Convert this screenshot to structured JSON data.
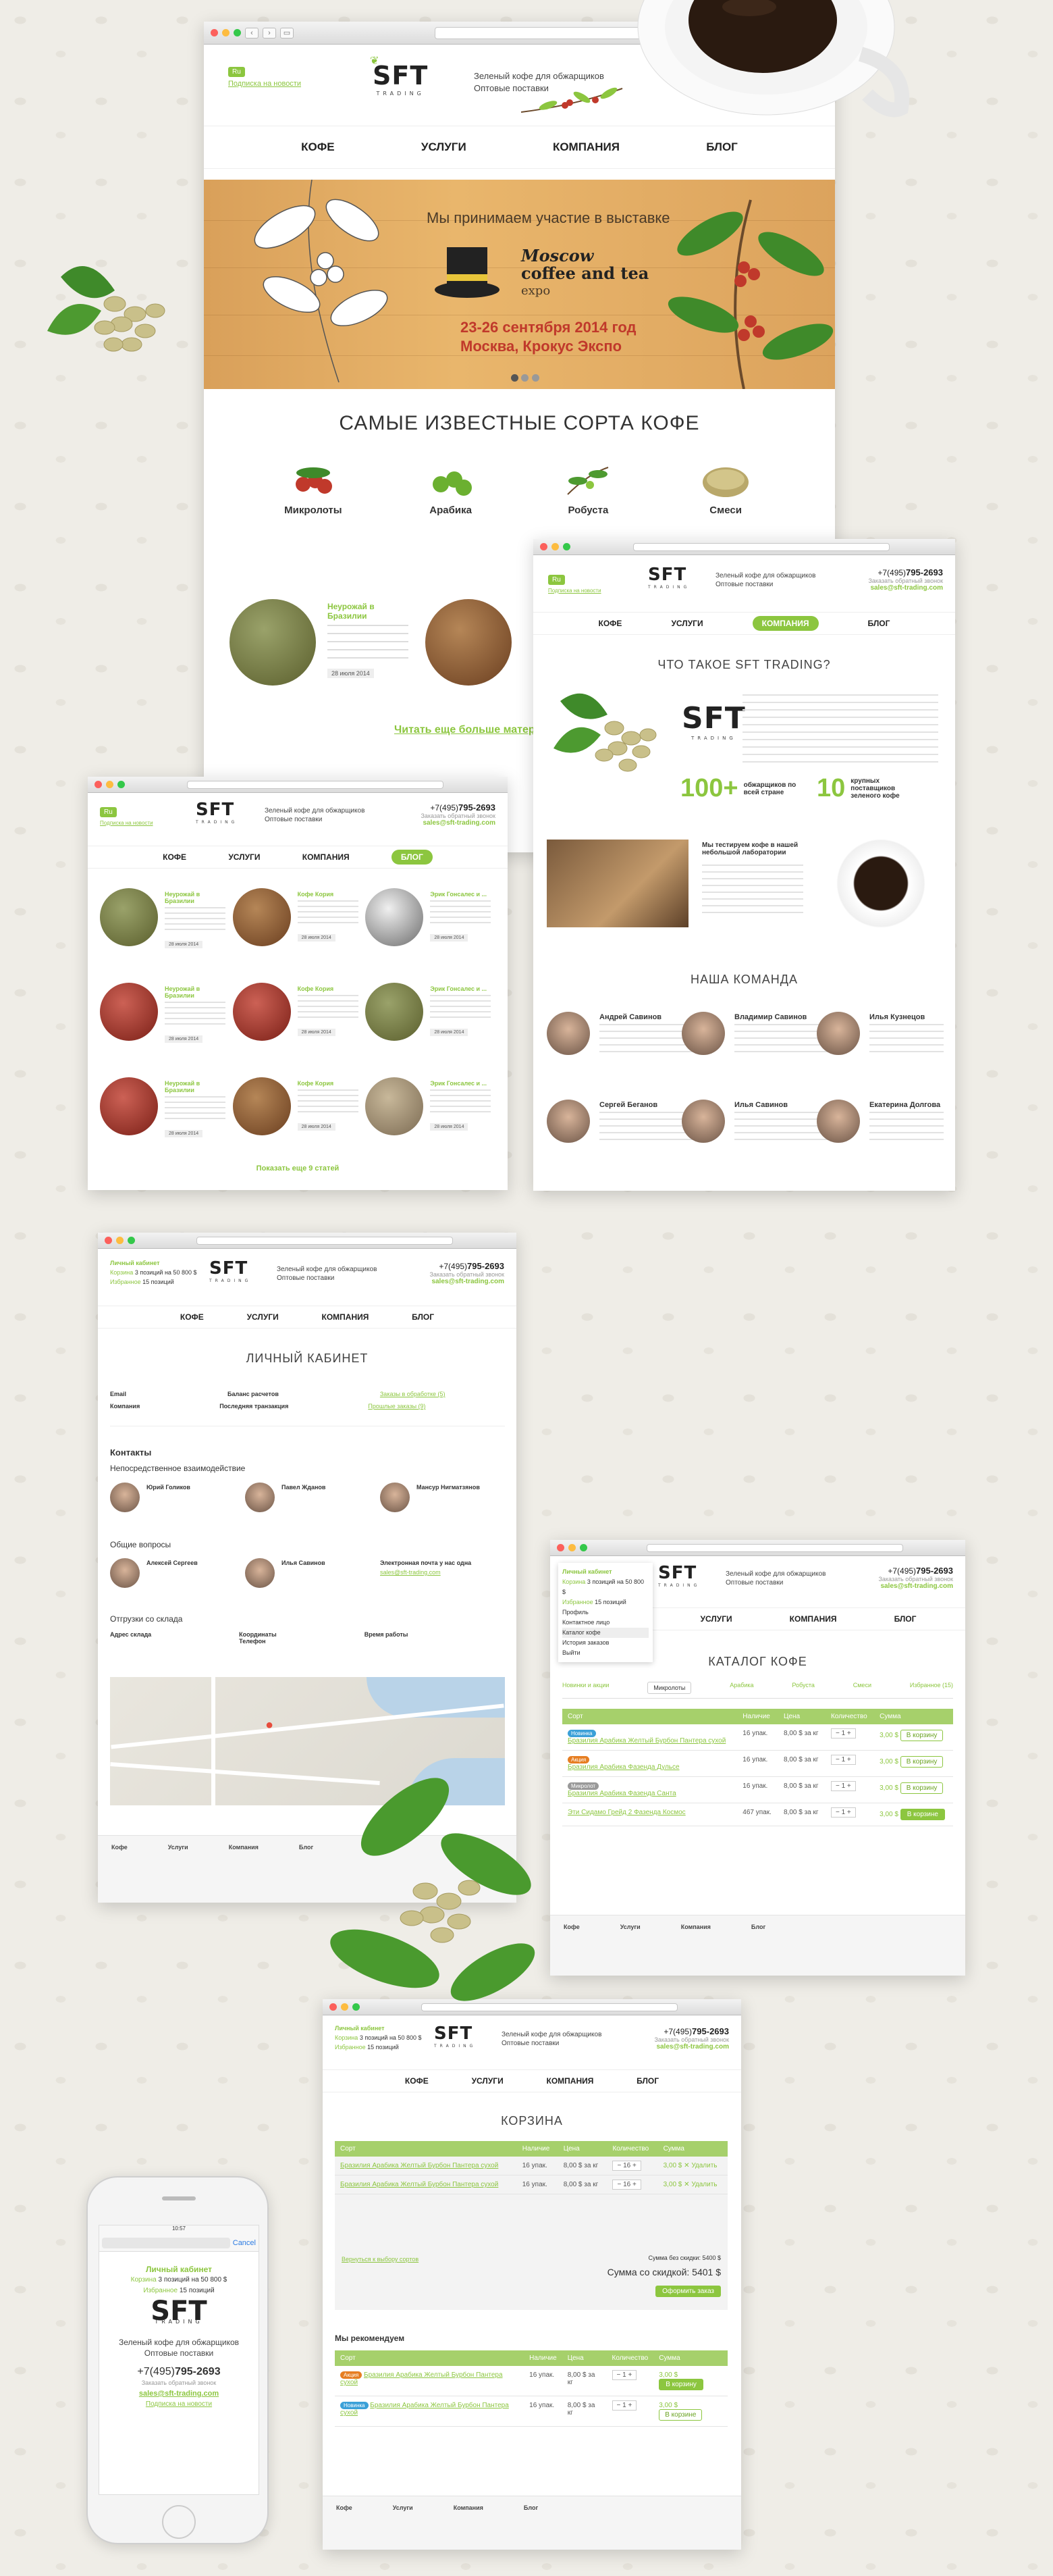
{
  "site": {
    "logo_main": "SFT",
    "logo_sub": "TRADING",
    "tagline_1": "Зеленый кофе для обжарщиков",
    "tagline_2": "Оптовые поставки",
    "lang": "Ru",
    "subscribe": "Подписка на новости",
    "phone_prefix": "+7(495)",
    "phone_number": "795-2693",
    "phone_note": "Заказать обратный звонок",
    "email": "sales@sft-trading.com",
    "menu": [
      "КОФЕ",
      "УСЛУГИ",
      "КОМПАНИЯ",
      "БЛОГ"
    ]
  },
  "hero": {
    "line1": "Мы принимаем участие в выставке",
    "expo1": "Moscow",
    "expo2": "coffee and tea",
    "expo3": "expo",
    "dates": "23-26 сентября 2014 год",
    "place": "Москва, Крокус Экспо"
  },
  "varieties": {
    "title": "САМЫЕ ИЗВЕСТНЫЕ СОРТА КОФЕ",
    "items": [
      "Микролоты",
      "Арабика",
      "Робуста",
      "Смеси"
    ]
  },
  "news_preview": {
    "item_title": "Неурожай в Бразилии",
    "item_date": "28 июля 2014",
    "more": "Читать еще больше матер"
  },
  "about": {
    "title": "ЧТО ТАКОЕ SFT TRADING?",
    "stat1_num": "100+",
    "stat1_txt": "обжарщиков по всей стране",
    "stat2_num": "10",
    "stat2_txt": "крупных поставщиков зеленого кофе",
    "lab_title": "Мы тестируем кофе в нашей небольшой лаборатории",
    "team_title": "НАША КОМАНДА",
    "team": [
      {
        "name": "Андрей Савинов"
      },
      {
        "name": "Владимир Савинов"
      },
      {
        "name": "Илья Кузнецов"
      },
      {
        "name": "Сергей Беганов"
      },
      {
        "name": "Илья Савинов"
      },
      {
        "name": "Екатерина Долгова"
      }
    ]
  },
  "blog": {
    "more_posts": "Показать еще 9 статей",
    "date": "28 июля 2014",
    "titles": [
      "Неурожай в Бразилии",
      "Кофе Кория",
      "Эрик Гонсалес и ...",
      "Неурожай в Бразилии",
      "Кофе Кория",
      "Эрик Гонсалес и ...",
      "Неурожай в Бразилии",
      "Кофе Кория",
      "Эрик Гонсалес и ..."
    ]
  },
  "cabinet": {
    "user_menu": "Личный кабинет",
    "cart_link": "Корзина",
    "cart_info": "3 позиций на 50 800 $",
    "fav_link": "Избранное",
    "fav_info": "15 позиций",
    "title": "ЛИЧНЫЙ КАБИНЕТ",
    "email_label": "Email",
    "company_label": "Компания",
    "balance_label": "Баланс расчетов",
    "last_label": "Последняя транзакция",
    "orders_link": "Заказы в обработке (5)",
    "history_link": "Прошлые заказы (9)",
    "contacts_title": "Контакты",
    "direct_title": "Непосредственное взаимодействие",
    "direct_people": [
      "Юрий Голиков",
      "Павел Жданов",
      "Мансур Нигматзянов"
    ],
    "general_title": "Общие вопросы",
    "general_people": [
      "Алексей Сергеев",
      "Илья Савинов"
    ],
    "email_note": "Электронная почта у нас одна",
    "stock_title": "Отгрузки со склада",
    "stock_address": "Адрес склада",
    "stock_coords": "Координаты",
    "stock_hours": "Время работы",
    "stock_phone": "Телефон"
  },
  "catalog": {
    "title": "КАТАЛОГ КОФЕ",
    "dropdown": [
      "Профиль",
      "Контактное лицо",
      "Каталог кофе",
      "История заказов",
      "Выйти"
    ],
    "tabs": [
      "Новинки и акции",
      "Микролоты",
      "Арабика",
      "Робуста",
      "Смеси",
      "Избранное (15)"
    ],
    "headers": [
      "Сорт",
      "Наличие",
      "Цена",
      "Количество",
      "Сумма"
    ],
    "rows": [
      {
        "name": "Бразилия Арабика Желтый Бурбон Пантера сухой",
        "badge": "Новинка",
        "stock": "16 упак.",
        "price": "8,00 $ за кг",
        "qty": "1",
        "sum": "3,00 $",
        "action": "В корзину"
      },
      {
        "name": "Бразилия Арабика Фазенда Дульсе",
        "badge": "Акция",
        "stock": "16 упак.",
        "price": "8,00 $ за кг",
        "qty": "1",
        "sum": "3,00 $",
        "action": "В корзину"
      },
      {
        "name": "Бразилия Арабика Фазенда Санта",
        "badge": "Микролот",
        "stock": "16 упак.",
        "price": "8,00 $ за кг",
        "qty": "1",
        "sum": "3,00 $",
        "action": "В корзину"
      },
      {
        "name": "Эти Сидамо Грейд 2 Фазенда Космос",
        "badge": "",
        "stock": "467 упак.",
        "price": "8,00 $ за кг",
        "qty": "1",
        "sum": "3,00 $",
        "action": "В корзине"
      }
    ],
    "footer_cols": [
      "Кофе",
      "Услуги",
      "Компания",
      "Блог"
    ]
  },
  "cart": {
    "title": "КОРЗИНА",
    "rows": [
      {
        "name": "Бразилия Арабика Желтый Бурбон Пантера сухой",
        "stock": "16 упак.",
        "price": "8,00 $ за кг",
        "qty": "16",
        "sum": "3,00 $",
        "action": "Удалить"
      },
      {
        "name": "Бразилия Арабика Желтый Бурбон Пантера сухой",
        "stock": "16 упак.",
        "price": "8,00 $ за кг",
        "qty": "16",
        "sum": "3,00 $",
        "action": "Удалить"
      }
    ],
    "back": "Вернуться к выбору сортов",
    "sum_label": "Сумма без скидки: 5400 $",
    "discount_label": "Сумма со скидкой: 5401 $",
    "order_btn": "Оформить заказ",
    "recommend_title": "Мы рекомендуем"
  },
  "mobile": {
    "time": "10:57",
    "cancel": "Cancel",
    "user_menu": "Личный кабинет"
  }
}
